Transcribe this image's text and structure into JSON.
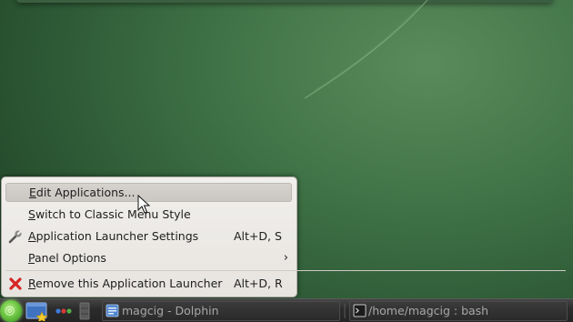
{
  "context_menu": {
    "items": [
      {
        "label": "Edit Applications...",
        "mnemonic_index": 0,
        "shortcut": "",
        "icon": "",
        "submenu": false,
        "highlighted": true
      },
      {
        "label": "Switch to Classic Menu Style",
        "mnemonic_index": 0,
        "shortcut": "",
        "icon": "",
        "submenu": false,
        "highlighted": false
      },
      {
        "label": "Application Launcher Settings",
        "mnemonic_index": 0,
        "shortcut": "Alt+D, S",
        "icon": "wrench-icon",
        "submenu": false,
        "highlighted": false
      },
      {
        "label": "Panel Options",
        "mnemonic_index": 0,
        "shortcut": "",
        "icon": "",
        "submenu": true,
        "highlighted": false
      },
      {
        "label": "Remove this Application Launcher",
        "mnemonic_index": 0,
        "shortcut": "Alt+D, R",
        "icon": "red-x-icon",
        "submenu": false,
        "highlighted": false
      }
    ],
    "submenu_arrow": "›"
  },
  "taskbar": {
    "launcher_icon": "opensuse-launcher-icon",
    "widgets": [
      "desktop-pager-icon",
      "system-tray-dots-icon",
      "panel-separator-icon"
    ],
    "tasks": [
      {
        "title": "magcig - Dolphin",
        "icon": "dolphin-file-manager-icon"
      },
      {
        "title": "/home/magcig : bash",
        "icon": "terminal-icon"
      }
    ]
  },
  "colors": {
    "desktop": "#3f7246",
    "menu_bg": "#ece9e5",
    "menu_highlight": "#cfccc8",
    "panel": "#2c2c2c",
    "task_text": "#a7a7a7",
    "launcher_green": "#6fc744",
    "remove_red": "#d52525"
  }
}
